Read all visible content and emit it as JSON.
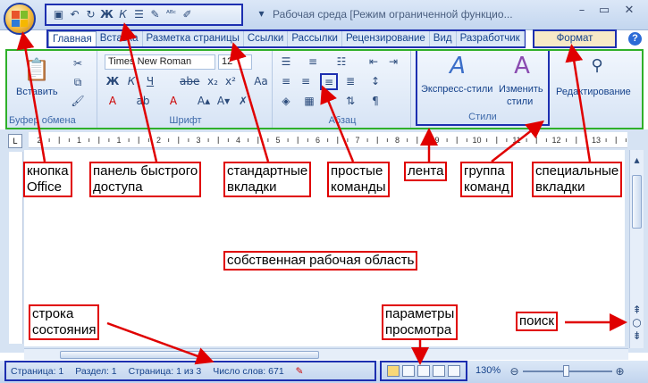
{
  "window": {
    "title": "Рабочая среда [Режим ограниченной функцио...",
    "buttons": [
      "–",
      "▭",
      "✕"
    ]
  },
  "quick_access": {
    "icons": [
      "save-icon",
      "undo-icon",
      "redo-icon",
      "bold-icon",
      "italic-icon",
      "list-icon",
      "edit-icon",
      "spellcheck-icon",
      "highlight-icon"
    ],
    "glyphs": [
      "▣",
      "↶",
      "↻",
      "Ж",
      "К",
      "☰",
      "✎",
      "ᴬᴮᶜ",
      "✐"
    ]
  },
  "tabs": [
    {
      "label": "Главная",
      "active": true
    },
    {
      "label": "Вставка"
    },
    {
      "label": "Разметка страницы"
    },
    {
      "label": "Ссылки"
    },
    {
      "label": "Рассылки"
    },
    {
      "label": "Рецензирование"
    },
    {
      "label": "Вид"
    },
    {
      "label": "Разработчик"
    }
  ],
  "special_tab": "Формат",
  "ribbon": {
    "clipboard": {
      "label": "Буфер обмена",
      "paste": "Вставить"
    },
    "font": {
      "label": "Шрифт",
      "name": "Times New Roman",
      "size": "12"
    },
    "paragraph": {
      "label": "Абзац"
    },
    "styles": {
      "label": "Стили",
      "express": "Экспресс-стили",
      "change": "Изменить",
      "change2": "стили"
    },
    "editing": {
      "label": "Редактирование"
    }
  },
  "ruler": {
    "numbers": [
      "2",
      "1",
      "1",
      "2",
      "3",
      "4",
      "5",
      "6",
      "7",
      "8",
      "9",
      "10",
      "11",
      "12",
      "13"
    ]
  },
  "status": {
    "page": "Страница: 1",
    "section": "Раздел: 1",
    "pages": "Страница: 1 из 3",
    "words": "Число слов: 671",
    "zoom": "130%"
  },
  "callouts": {
    "office": [
      "кнопка",
      "Office"
    ],
    "qat": [
      "панель быстрого",
      "доступа"
    ],
    "tabs": [
      "стандартные",
      "вкладки"
    ],
    "simple": [
      "простые",
      "команды"
    ],
    "ribbon": "лента",
    "group": [
      "группа",
      "команд"
    ],
    "special": [
      "специальные",
      "вкладки"
    ],
    "workspace": "собственная рабочая область",
    "statusbar": [
      "строка",
      "состояния"
    ],
    "view": [
      "параметры",
      "просмотра"
    ],
    "search": "поиск"
  }
}
